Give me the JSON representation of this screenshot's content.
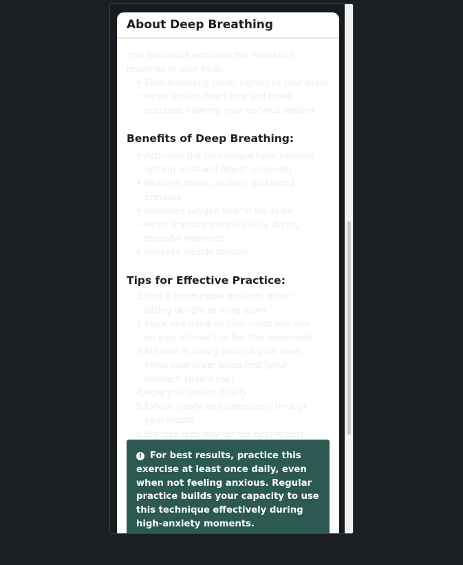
{
  "modal": {
    "title": "About Deep Breathing"
  },
  "intro_lines": [
    "This technique activates the relaxation",
    "response in your body."
  ],
  "intro_list": [
    {
      "num": "•",
      "text": "Slow breathing sends signals to your brain"
    },
    {
      "num": "•",
      "text": "Helps reduce heart rate and blood"
    },
    {
      "num": "",
      "text": "pressure, calming your nervous system"
    }
  ],
  "benefits": {
    "title": "Benefits of Deep Breathing:",
    "items": [
      {
        "num": "•",
        "text": "Activates the parasympathetic nervous"
      },
      {
        "num": "",
        "text": "system (rest-and-digest response)"
      },
      {
        "num": "•",
        "text": "Reduces stress, anxiety, and blood pressure"
      },
      {
        "num": "•",
        "text": "Increases oxygen flow to the brain"
      },
      {
        "num": "•",
        "text": "Helps improve mental clarity during"
      },
      {
        "num": "",
        "text": "stressful moments"
      },
      {
        "num": "•",
        "text": "Relieves muscle tension"
      }
    ]
  },
  "tips": {
    "title": "Tips for Effective Practice:",
    "items": [
      {
        "num": "1.",
        "text": "Find a comfortable position, either"
      },
      {
        "num": "",
        "text": "sitting upright or lying down"
      },
      {
        "num": "2.",
        "text": "Place one hand on your chest and one"
      },
      {
        "num": "",
        "text": "on your stomach to feel the movement"
      },
      {
        "num": "3.",
        "text": "Breathe in slowly through your nose,"
      },
      {
        "num": "",
        "text": "filling your lower lungs first (your"
      },
      {
        "num": "",
        "text": "stomach should rise)"
      },
      {
        "num": "4.",
        "text": "Hold your breath briefly"
      },
      {
        "num": "5.",
        "text": "Exhale slowly and completely through"
      },
      {
        "num": "",
        "text": "your mouth"
      },
      {
        "num": "6.",
        "text": "Practice regularly for the best results"
      }
    ]
  },
  "notice": {
    "icon": "info-icon",
    "text": "For best results, practice this exercise at least once daily, even when not feeling anxious. Regular practice builds your capacity to use this technique effectively during high-anxiety moments."
  },
  "colors": {
    "notice_bg": "#2c5a52",
    "header_border": "#f3e3cc",
    "page_bg": "#1b1f24"
  }
}
